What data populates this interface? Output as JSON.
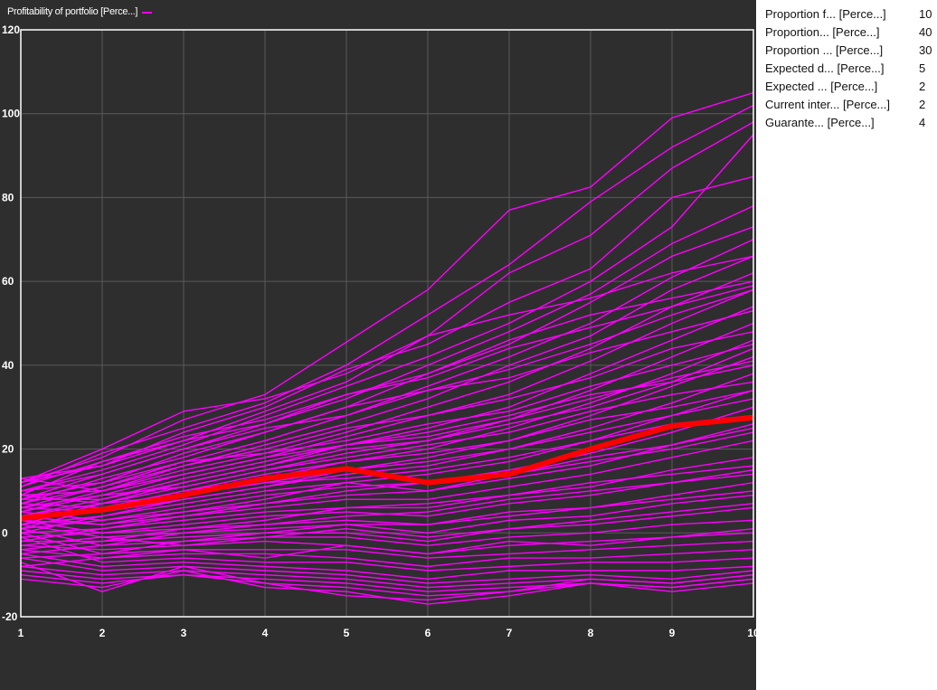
{
  "legend": {
    "label": "Profitability of portfolio [Perce...]",
    "color": "#ff00ff"
  },
  "parameters": [
    {
      "label": "Proportion f... [Perce...]",
      "value": "10"
    },
    {
      "label": "Proportion... [Perce...]",
      "value": "40"
    },
    {
      "label": "Proportion ... [Perce...]",
      "value": "30"
    },
    {
      "label": "Expected d... [Perce...]",
      "value": "5"
    },
    {
      "label": "Expected ... [Perce...]",
      "value": "2"
    },
    {
      "label": "Current inter... [Perce...]",
      "value": "2"
    },
    {
      "label": "Guarante... [Perce...]",
      "value": "4"
    }
  ],
  "chart_data": {
    "type": "line",
    "x": [
      1,
      2,
      3,
      4,
      5,
      6,
      7,
      8,
      9,
      10
    ],
    "xlim": [
      1,
      10
    ],
    "ylim": [
      -20,
      120
    ],
    "xticks": [
      "1",
      "2",
      "3",
      "4",
      "5",
      "6",
      "7",
      "8",
      "9",
      "10"
    ],
    "yticks": [
      "120",
      "100",
      "80",
      "60",
      "40",
      "20",
      "0",
      "-20"
    ],
    "grid": true,
    "legend_position": "top-left",
    "colors": {
      "simulation": "#ff00ff",
      "mean": "#ff0000",
      "background": "#2e2e2e",
      "grid": "#5a5a5a"
    },
    "highlight": {
      "values": [
        3.5,
        5.5,
        9,
        13,
        15.3,
        12,
        14,
        20,
        25.5,
        27.5
      ]
    },
    "series": [
      {
        "values": [
          12,
          18,
          27,
          33,
          45.5,
          58,
          77,
          82.5,
          99,
          105
        ]
      },
      {
        "values": [
          11,
          19,
          25,
          31,
          40,
          52,
          64,
          79,
          92,
          102
        ]
      },
      {
        "values": [
          9,
          17,
          22,
          29,
          36,
          47,
          62,
          71,
          87,
          98
        ]
      },
      {
        "values": [
          13,
          16,
          24,
          30,
          39,
          45,
          55,
          63,
          80,
          85
        ]
      },
      {
        "values": [
          10,
          15,
          21,
          28,
          35,
          42,
          50,
          60,
          73,
          95
        ]
      },
      {
        "values": [
          8,
          14,
          20,
          26,
          32,
          40,
          48,
          57,
          69,
          78
        ]
      },
      {
        "values": [
          7,
          13,
          18,
          24,
          30,
          38,
          45,
          55,
          66,
          73
        ]
      },
      {
        "values": [
          10,
          12,
          17,
          22,
          28,
          35,
          42,
          50,
          61,
          70
        ]
      },
      {
        "values": [
          6,
          11,
          16,
          21,
          26,
          32,
          40,
          47,
          58,
          66
        ]
      },
      {
        "values": [
          9,
          10,
          15,
          19,
          24,
          30,
          36,
          44,
          54,
          62
        ]
      },
      {
        "values": [
          5,
          9,
          14,
          18,
          23,
          28,
          33,
          41,
          50,
          58
        ]
      },
      {
        "values": [
          8,
          8,
          12,
          16,
          21,
          25,
          30,
          38,
          46,
          54
        ]
      },
      {
        "values": [
          4,
          7,
          11,
          15,
          19,
          22,
          27,
          34,
          42,
          50
        ]
      },
      {
        "values": [
          7,
          6,
          10,
          14,
          17,
          20,
          25,
          31,
          38,
          46
        ]
      },
      {
        "values": [
          3,
          6,
          9,
          12,
          15,
          18,
          22,
          28,
          35,
          42
        ]
      },
      {
        "values": [
          6,
          5,
          8,
          11,
          14,
          16,
          20,
          25,
          31,
          38
        ]
      },
      {
        "values": [
          2,
          4,
          7,
          10,
          12,
          14,
          17,
          22,
          28,
          34
        ]
      },
      {
        "values": [
          5,
          3,
          6,
          9,
          11,
          12,
          15,
          19,
          24,
          30
        ]
      },
      {
        "values": [
          1,
          3,
          5,
          7,
          9,
          10,
          13,
          16,
          21,
          26
        ]
      },
      {
        "values": [
          4,
          2,
          4,
          6,
          8,
          8,
          11,
          14,
          18,
          22
        ]
      },
      {
        "values": [
          0,
          1,
          3,
          5,
          6,
          6,
          9,
          11,
          15,
          18
        ]
      },
      {
        "values": [
          3,
          0,
          2,
          4,
          5,
          4,
          7,
          9,
          12,
          15
        ]
      },
      {
        "values": [
          -1,
          0,
          1,
          2,
          3,
          2,
          5,
          6,
          9,
          12
        ]
      },
      {
        "values": [
          2,
          -1,
          0,
          1,
          2,
          0,
          3,
          4,
          7,
          9
        ]
      },
      {
        "values": [
          -2,
          -2,
          -1,
          0,
          0,
          -2,
          1,
          2,
          4,
          6
        ]
      },
      {
        "values": [
          1,
          -3,
          -2,
          -1,
          -1,
          -3,
          -1,
          0,
          2,
          3
        ]
      },
      {
        "values": [
          -3,
          -4,
          -3,
          -2,
          -3,
          -5,
          -3,
          -2,
          -1,
          0
        ]
      },
      {
        "values": [
          0,
          -5,
          -4,
          -4,
          -4,
          -6,
          -5,
          -4,
          -3,
          -2
        ]
      },
      {
        "values": [
          -4,
          -6,
          -5,
          -5,
          -6,
          -8,
          -6,
          -6,
          -5,
          -4
        ]
      },
      {
        "values": [
          -1,
          -7,
          -6,
          -7,
          -7,
          -9,
          -8,
          -7,
          -7,
          -6
        ]
      },
      {
        "values": [
          -5,
          -8,
          -7,
          -8,
          -9,
          -11,
          -9,
          -9,
          -9,
          -8
        ]
      },
      {
        "values": [
          -6,
          -9,
          -8,
          -9,
          -10,
          -12,
          -11,
          -10,
          -11,
          -9
        ]
      },
      {
        "values": [
          -8,
          -10,
          -9,
          -10,
          -11,
          -13,
          -12,
          -11,
          -12,
          -10
        ]
      },
      {
        "values": [
          -9,
          -11,
          -10,
          -11,
          -12,
          -14,
          -13,
          -12,
          -13,
          -11
        ]
      },
      {
        "values": [
          -10,
          -12,
          -10,
          -12,
          -13,
          -15,
          -14,
          -12,
          -14,
          -12
        ]
      },
      {
        "values": [
          -11,
          -13,
          -9,
          -13,
          -14,
          -17,
          -15,
          -12,
          -13,
          -11
        ]
      },
      {
        "values": [
          -7,
          -14,
          -8,
          -12,
          -15,
          -16,
          -14,
          -11,
          -12,
          -10
        ]
      },
      {
        "values": [
          12,
          20,
          29,
          32,
          38,
          47,
          52,
          56,
          62,
          66
        ]
      },
      {
        "values": [
          11,
          17,
          23,
          27,
          33,
          38,
          46,
          52,
          56,
          60
        ]
      },
      {
        "values": [
          8,
          12,
          19,
          24,
          30,
          34,
          39,
          45,
          52,
          58
        ]
      },
      {
        "values": [
          5,
          10,
          16,
          20,
          25,
          28,
          32,
          37,
          44,
          48
        ]
      },
      {
        "values": [
          2,
          7,
          12,
          16,
          20,
          22,
          26,
          30,
          36,
          40
        ]
      },
      {
        "values": [
          0,
          4,
          8,
          11,
          15,
          17,
          20,
          24,
          28,
          32
        ]
      },
      {
        "values": [
          -2,
          1,
          4,
          7,
          10,
          12,
          14,
          17,
          20,
          24
        ]
      },
      {
        "values": [
          -4,
          -2,
          1,
          3,
          6,
          7,
          9,
          12,
          14,
          16
        ]
      },
      {
        "values": [
          -6,
          -5,
          -2,
          0,
          2,
          2,
          4,
          6,
          8,
          10
        ]
      },
      {
        "values": [
          13,
          10,
          14,
          18,
          21,
          24,
          28,
          33,
          36,
          44
        ]
      },
      {
        "values": [
          6,
          9,
          11,
          15,
          18,
          21,
          24,
          29,
          33,
          36
        ]
      },
      {
        "values": [
          3,
          2,
          5,
          8,
          12,
          10,
          14,
          18,
          21,
          25
        ]
      },
      {
        "values": [
          9,
          7,
          9,
          12,
          13,
          15,
          18,
          22,
          26,
          28
        ]
      },
      {
        "values": [
          -3,
          -1,
          -3,
          -1,
          1,
          -1,
          1,
          3,
          5,
          7
        ]
      },
      {
        "values": [
          -8,
          -6,
          -4,
          -6,
          -3,
          -5,
          -2,
          -3,
          -1,
          1
        ]
      },
      {
        "values": [
          10,
          14,
          20,
          25,
          28,
          34,
          37,
          43,
          48,
          53
        ]
      },
      {
        "values": [
          7,
          11,
          17,
          19,
          22,
          26,
          29,
          35,
          40,
          45
        ]
      },
      {
        "values": [
          12,
          16,
          22,
          26,
          33,
          37,
          44,
          49,
          54,
          59
        ]
      },
      {
        "values": [
          1,
          6,
          10,
          13,
          17,
          19,
          22,
          27,
          30,
          34
        ]
      },
      {
        "values": [
          -5,
          -3,
          0,
          2,
          4,
          5,
          8,
          10,
          12,
          14
        ]
      },
      {
        "values": [
          4,
          8,
          13,
          17,
          21,
          23,
          27,
          32,
          37,
          41
        ]
      }
    ]
  }
}
